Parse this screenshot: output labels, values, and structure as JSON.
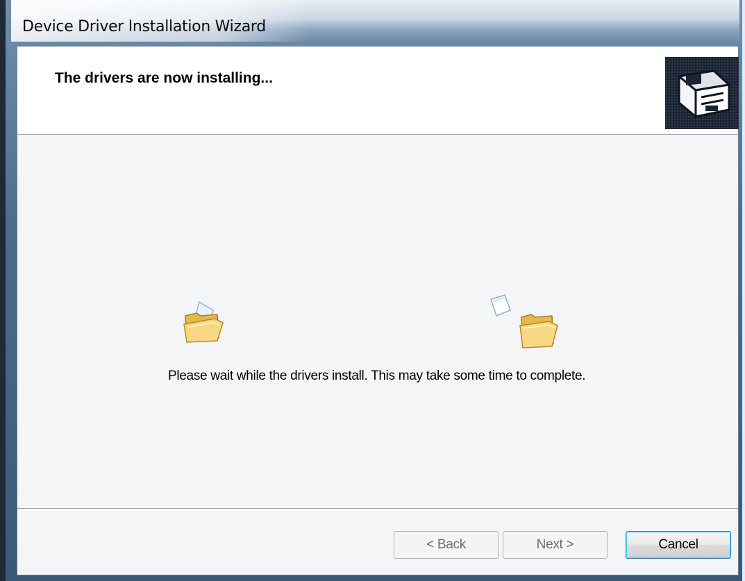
{
  "window": {
    "title": "Device Driver Installation Wizard"
  },
  "header": {
    "title": "The drivers are now installing...",
    "icon": "hardware-install-icon"
  },
  "body": {
    "message": "Please wait while the drivers install. This may take some time to complete.",
    "animation_icons": [
      "folder-source-icon",
      "flying-document-icon",
      "folder-destination-icon"
    ]
  },
  "buttons": {
    "back_label": "< Back",
    "next_label": "Next >",
    "cancel_label": "Cancel"
  },
  "colors": {
    "folder": "#f2c14e",
    "header_bg": "#ffffff",
    "content_bg": "#f4f5f6",
    "focus_border": "#3c7fb1"
  }
}
